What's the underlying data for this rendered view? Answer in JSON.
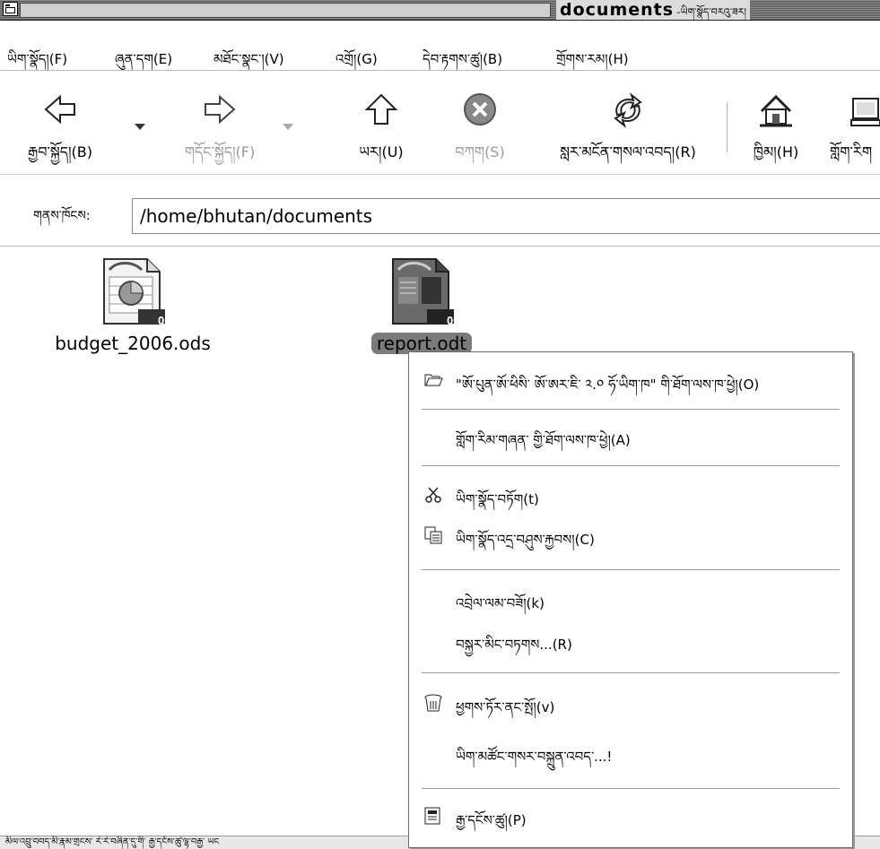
{
  "window": {
    "title": "documents",
    "title_suffix": " -ཡིག་སྣོད་བརའུ་ཟར།"
  },
  "menubar": [
    {
      "label": "ཡིག་སྣོད།(F)"
    },
    {
      "label": "ཞུན་དག(E)"
    },
    {
      "label": "མཐོང་སྣང་།(V)"
    },
    {
      "label": "འགྲོ།(G)"
    },
    {
      "label": "དེབ་རྟགས་ཚུ།(B)"
    },
    {
      "label": "གྲོགས་རམ།(H)"
    }
  ],
  "toolbar": {
    "back": "རྒྱབ་སྐྱོད།(B)",
    "forward": "གདོང་སྐྱོད།(F)",
    "up": "ཡར།(U)",
    "stop": "བཀག(S)",
    "reload": "སླར་མངོན་གསལ་འབད།(R)",
    "home": "ཁྱིམ།(H)",
    "computer": "གློག་རིག"
  },
  "location": {
    "label": "གནས་ཁོངས:",
    "value": "/home/bhutan/documents"
  },
  "files": [
    {
      "name": "budget_2006.ods",
      "icon": "spreadsheet-icon",
      "badge": "OOS"
    },
    {
      "name": "report.odt",
      "icon": "text-document-icon",
      "badge": "OOT",
      "selected": true
    }
  ],
  "context_menu": {
    "open_with": "\"ཨོ་པུན་ཨོ་ཕིསི་ ཨོ་ཨར་ཇི་ ༢.༠ ཧོ་ཡིག་ཁ\" གི་ཐོག་ལས་ཁ་ཕྱེ།(O)",
    "open_with_other": "གློག་རིམ་གཞན་ གྱི་ཐོག་ལས་ཁ་ཕྱེ།(A)",
    "cut": "ཡིག་སྣོད་བཏོག(t)",
    "copy": "ཡིག་སྣོད་འདྲ་བཤུས་རྐྱབས།(C)",
    "make_link": "འབྲེལ་ལམ་བཟོ།(k)",
    "rename": "བསྐྱར་མིང་བཏགས...(R)",
    "trash": "ཕྱགས་ཏོར་ནང་སྤོ།(v)",
    "properties": "ཡིག་མཚོང་གསར་བསྐྲུན་འབད་...!",
    "properties_last": "རྒྱ་དངོས་ཚུ།(P)"
  },
  "statusbar": {
    "text": "མིལ་འབྲུ་བབད་མི་རྣམ་གྲངས་ རེ་རེ་བཞིན་དུ་གི་ རྒྱ་དངོས་ཚུ་ལྷ་བརྒྱ་ ཡང"
  },
  "colors": {
    "selection": "#7b7b7b",
    "titlebar": "#6d6d6d"
  }
}
